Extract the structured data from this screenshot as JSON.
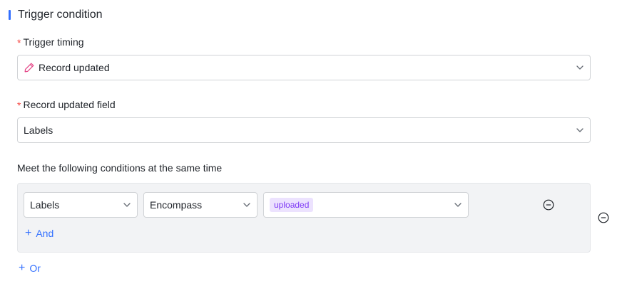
{
  "section": {
    "title": "Trigger condition"
  },
  "trigger_timing": {
    "label": "Trigger timing",
    "value": "Record updated",
    "icon": "pencil-icon"
  },
  "updated_field": {
    "label": "Record updated field",
    "value": "Labels"
  },
  "conditions": {
    "title": "Meet the following conditions at the same time",
    "rows": [
      {
        "field": "Labels",
        "operator": "Encompass",
        "tag": "uploaded"
      }
    ],
    "and_label": "And",
    "or_label": "Or"
  },
  "colors": {
    "accent": "#3370ff",
    "required": "#f54a45",
    "tag_bg": "#ece2fe",
    "tag_text": "#7f3bf5",
    "pencil": "#e54b8a"
  }
}
